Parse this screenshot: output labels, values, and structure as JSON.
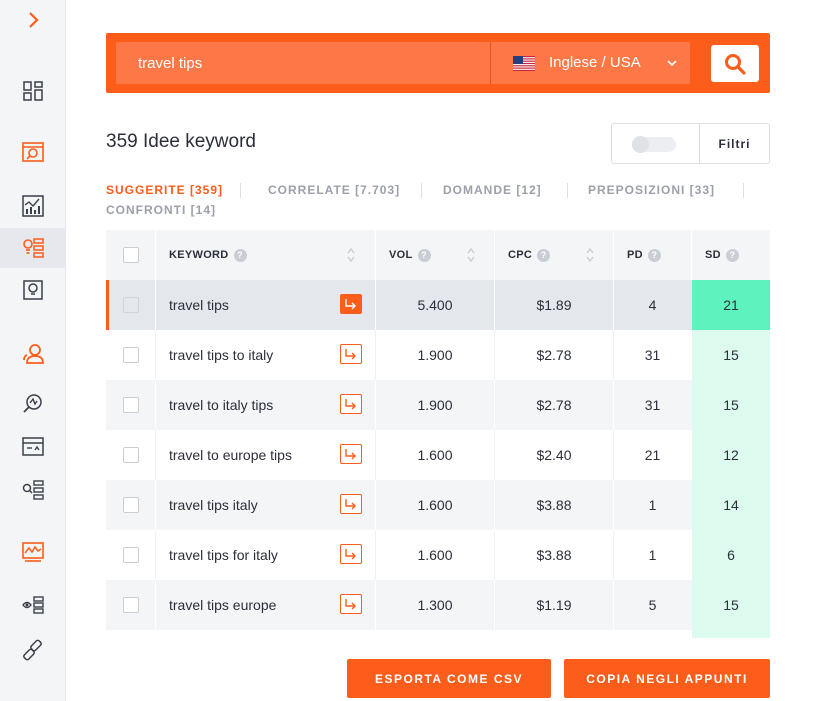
{
  "search": {
    "query": "travel tips",
    "language": "Inglese / USA"
  },
  "page": {
    "title": "359 Idee keyword",
    "filter_label": "Filtri"
  },
  "tabs": [
    {
      "label": "SUGGERITE [359]",
      "active": true
    },
    {
      "label": "CORRELATE [7.703]",
      "active": false
    },
    {
      "label": "DOMANDE [12]",
      "active": false
    },
    {
      "label": "PREPOSIZIONI [33]",
      "active": false
    },
    {
      "label": "CONFRONTI [14]",
      "active": false
    }
  ],
  "table": {
    "headers": {
      "keyword": "KEYWORD",
      "vol": "VOL",
      "cpc": "CPC",
      "pd": "PD",
      "sd": "SD"
    },
    "rows": [
      {
        "keyword": "travel tips",
        "vol": "5.400",
        "cpc": "$1.89",
        "pd": "4",
        "sd": "21",
        "sd_color": "#5ef2be"
      },
      {
        "keyword": "travel tips to italy",
        "vol": "1.900",
        "cpc": "$2.78",
        "pd": "31",
        "sd": "15",
        "sd_color": "#dcfbee"
      },
      {
        "keyword": "travel to italy tips",
        "vol": "1.900",
        "cpc": "$2.78",
        "pd": "31",
        "sd": "15",
        "sd_color": "#dcfbee"
      },
      {
        "keyword": "travel to europe tips",
        "vol": "1.600",
        "cpc": "$2.40",
        "pd": "21",
        "sd": "12",
        "sd_color": "#dcfbee"
      },
      {
        "keyword": "travel tips italy",
        "vol": "1.600",
        "cpc": "$3.88",
        "pd": "1",
        "sd": "14",
        "sd_color": "#dcfbee"
      },
      {
        "keyword": "travel tips for italy",
        "vol": "1.600",
        "cpc": "$3.88",
        "pd": "1",
        "sd": "6",
        "sd_color": "#dcfbee"
      },
      {
        "keyword": "travel tips europe",
        "vol": "1.300",
        "cpc": "$1.19",
        "pd": "5",
        "sd": "15",
        "sd_color": "#dcfbee"
      }
    ]
  },
  "actions": {
    "export_csv": "ESPORTA COME CSV",
    "copy_clipboard": "COPIA NEGLI APPUNTI"
  },
  "colors": {
    "accent": "#fd5d1a",
    "sd_high": "#5ef2be",
    "sd_low": "#dcfbee"
  },
  "sidebar_icons": [
    "chevron-right-icon",
    "dashboard-icon",
    "serp-analyzer-icon",
    "chart-icon",
    "keyword-ideas-icon",
    "content-ideas-icon",
    "users-icon",
    "site-audit-icon",
    "calendar-icon",
    "search-list-icon",
    "traffic-analytics-icon",
    "watch-list-icon",
    "link-icon"
  ]
}
